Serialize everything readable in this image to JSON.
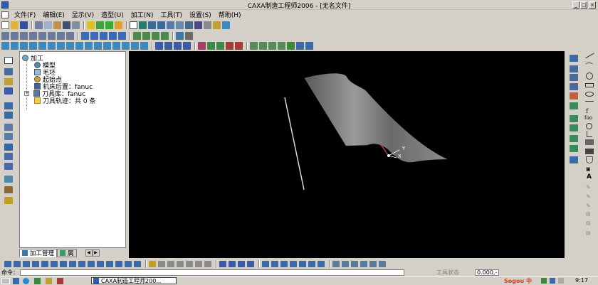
{
  "window": {
    "title": "CAXA制造工程师2006 - [无名文件]"
  },
  "menu": [
    "文件(F)",
    "编辑(E)",
    "显示(V)",
    "造型(U)",
    "加工(N)",
    "工具(T)",
    "设置(S)",
    "帮助(H)"
  ],
  "tree": {
    "root": "加工",
    "items": [
      "模型",
      "毛坯",
      "起始点",
      "机床后置：fanuc",
      "刀具库：fanuc",
      "刀具轨迹：共 0 条"
    ]
  },
  "tabs": {
    "process": "加工管理",
    "attr": "属"
  },
  "viewport": {
    "axis_y": "Y",
    "axis_x": "X"
  },
  "command": {
    "label": "命令：",
    "status_label": "工具状态",
    "coords": "0.000,-"
  },
  "taskbar": {
    "window_button": "CAXA制造工程师200...",
    "ime": "Sogou 中",
    "clock": "9:17"
  },
  "colors": {
    "viewport_bg": "#000000",
    "surface": "#8a8a8a",
    "accent": "#0a246a"
  }
}
